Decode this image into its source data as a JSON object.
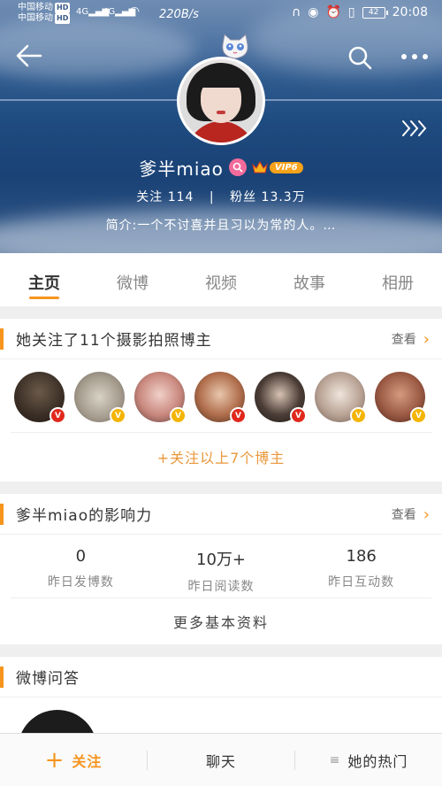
{
  "status_bar": {
    "carrier1": "中国移动",
    "carrier2": "中国移动",
    "hd": "HD",
    "net": "4G",
    "speed": "220B/s",
    "battery": "42",
    "time": "20:08"
  },
  "profile": {
    "username": "爹半miao",
    "vip_label": "VIP6",
    "following_label": "关注",
    "following_count": "114",
    "followers_label": "粉丝",
    "followers_count": "13.3万",
    "bio": "简介:一个不讨喜并且习以为常的人。…"
  },
  "tabs": [
    {
      "label": "主页",
      "active": true
    },
    {
      "label": "微博",
      "active": false
    },
    {
      "label": "视频",
      "active": false
    },
    {
      "label": "故事",
      "active": false
    },
    {
      "label": "相册",
      "active": false
    }
  ],
  "follow_card": {
    "title": "她关注了11个摄影拍照博主",
    "more": "查看",
    "follow_more": "+关注以上7个博主",
    "avatars": [
      {
        "badge": "V",
        "badge_color": "#e0281d"
      },
      {
        "badge": "V",
        "badge_color": "#f4b400"
      },
      {
        "badge": "V",
        "badge_color": "#f4b400"
      },
      {
        "badge": "V",
        "badge_color": "#e0281d"
      },
      {
        "badge": "V",
        "badge_color": "#e0281d"
      },
      {
        "badge": "V",
        "badge_color": "#f4b400"
      },
      {
        "badge": "V",
        "badge_color": "#f4b400"
      }
    ]
  },
  "influence_card": {
    "title": "爹半miao的影响力",
    "more": "查看",
    "metrics": [
      {
        "value": "0",
        "label": "昨日发博数"
      },
      {
        "value": "10万+",
        "label": "昨日阅读数"
      },
      {
        "value": "186",
        "label": "昨日互动数"
      }
    ],
    "basic_info": "更多基本资料"
  },
  "qa_card": {
    "title": "微博问答"
  },
  "bottom_bar": {
    "follow": "关注",
    "chat": "聊天",
    "hot": "她的热门"
  },
  "colors": {
    "accent": "#f7941d",
    "follow_more_text": "#e9973b"
  }
}
